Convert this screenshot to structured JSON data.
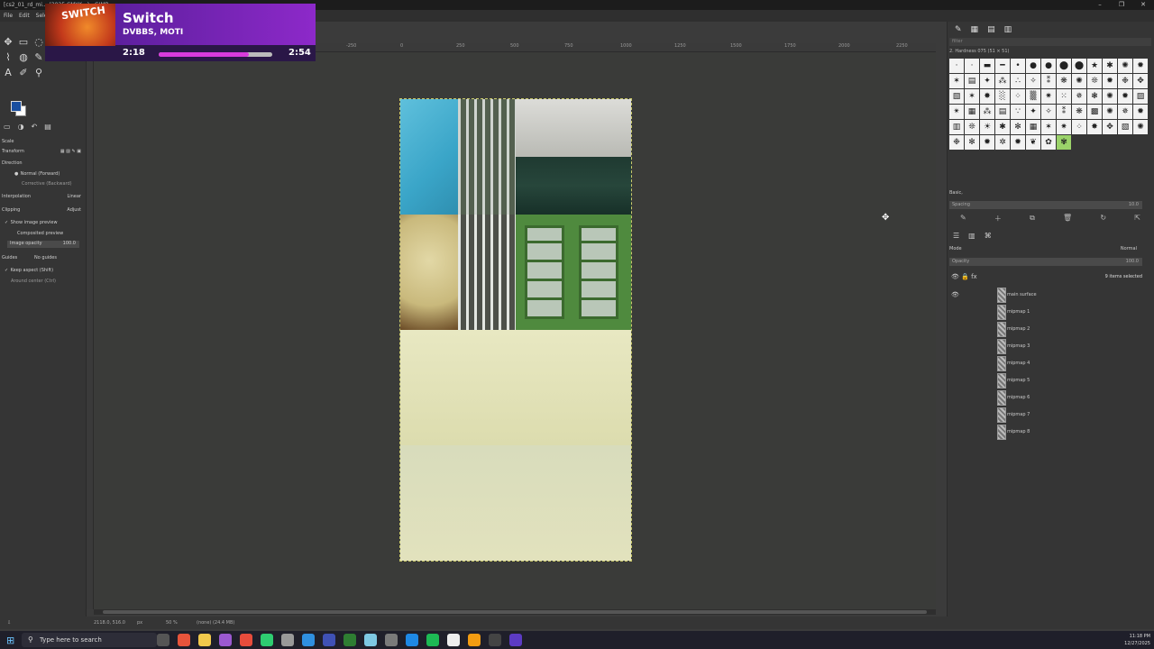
{
  "titlebar": {
    "title": "[cs2_01_rd_mi... (2025 CMYK...) - GIMP"
  },
  "menu": [
    "File",
    "Edit",
    "Select"
  ],
  "tool_options": {
    "tool": "Scale",
    "transform_label": "Transform",
    "direction_label": "Direction",
    "direction_normal": "Normal (Forward)",
    "direction_corrective": "Corrective (Backward)",
    "interpolation_label": "Interpolation",
    "interpolation_value": "Linear",
    "clipping_label": "Clipping",
    "clipping_value": "Adjust",
    "show_preview": "Show image preview",
    "composited_preview": "Composited preview",
    "image_opacity_label": "Image opacity",
    "image_opacity_value": "100.0",
    "guides_label": "Guides",
    "guides_value": "No guides",
    "keep_aspect": "Keep aspect (Shift)",
    "around_center": "Around center (Ctrl)"
  },
  "ruler_ticks": [
    "-250",
    "0",
    "250",
    "500",
    "750",
    "1000",
    "1250",
    "1500",
    "1750",
    "2000",
    "2250"
  ],
  "brushes_panel": {
    "filter_placeholder": "filter",
    "brush_name": "2. Hardness 075 (51 × 51)",
    "preset": "Basic,",
    "spacing_label": "Spacing",
    "spacing_value": "10.0"
  },
  "layers_panel": {
    "mode_label": "Mode",
    "mode_value": "Normal",
    "opacity_label": "Opacity",
    "opacity_value": "100.0",
    "selection_count": "9 items selected",
    "layers": [
      {
        "name": "main surface",
        "visible": true
      },
      {
        "name": "mipmap 1",
        "visible": false
      },
      {
        "name": "mipmap 2",
        "visible": false
      },
      {
        "name": "mipmap 3",
        "visible": false
      },
      {
        "name": "mipmap 4",
        "visible": false
      },
      {
        "name": "mipmap 5",
        "visible": false
      },
      {
        "name": "mipmap 6",
        "visible": false
      },
      {
        "name": "mipmap 7",
        "visible": false
      },
      {
        "name": "mipmap 8",
        "visible": false
      }
    ]
  },
  "status": {
    "coords": "2118.0, 516.0",
    "unit": "px",
    "zoom": "50 %",
    "info": "(none) (24.4 MB)"
  },
  "music": {
    "badge": "SWITCH",
    "title": "Switch",
    "artist": "DVBBS, MOTI",
    "elapsed": "2:18",
    "duration": "2:54",
    "progress": 0.79
  },
  "taskbar": {
    "search_placeholder": "Type here to search",
    "time": "11:18 PM",
    "date": "12/27/2025"
  },
  "colors": {
    "fg": "#1a4fa0",
    "bg": "#ffffff",
    "accent": "#8d29c9"
  }
}
